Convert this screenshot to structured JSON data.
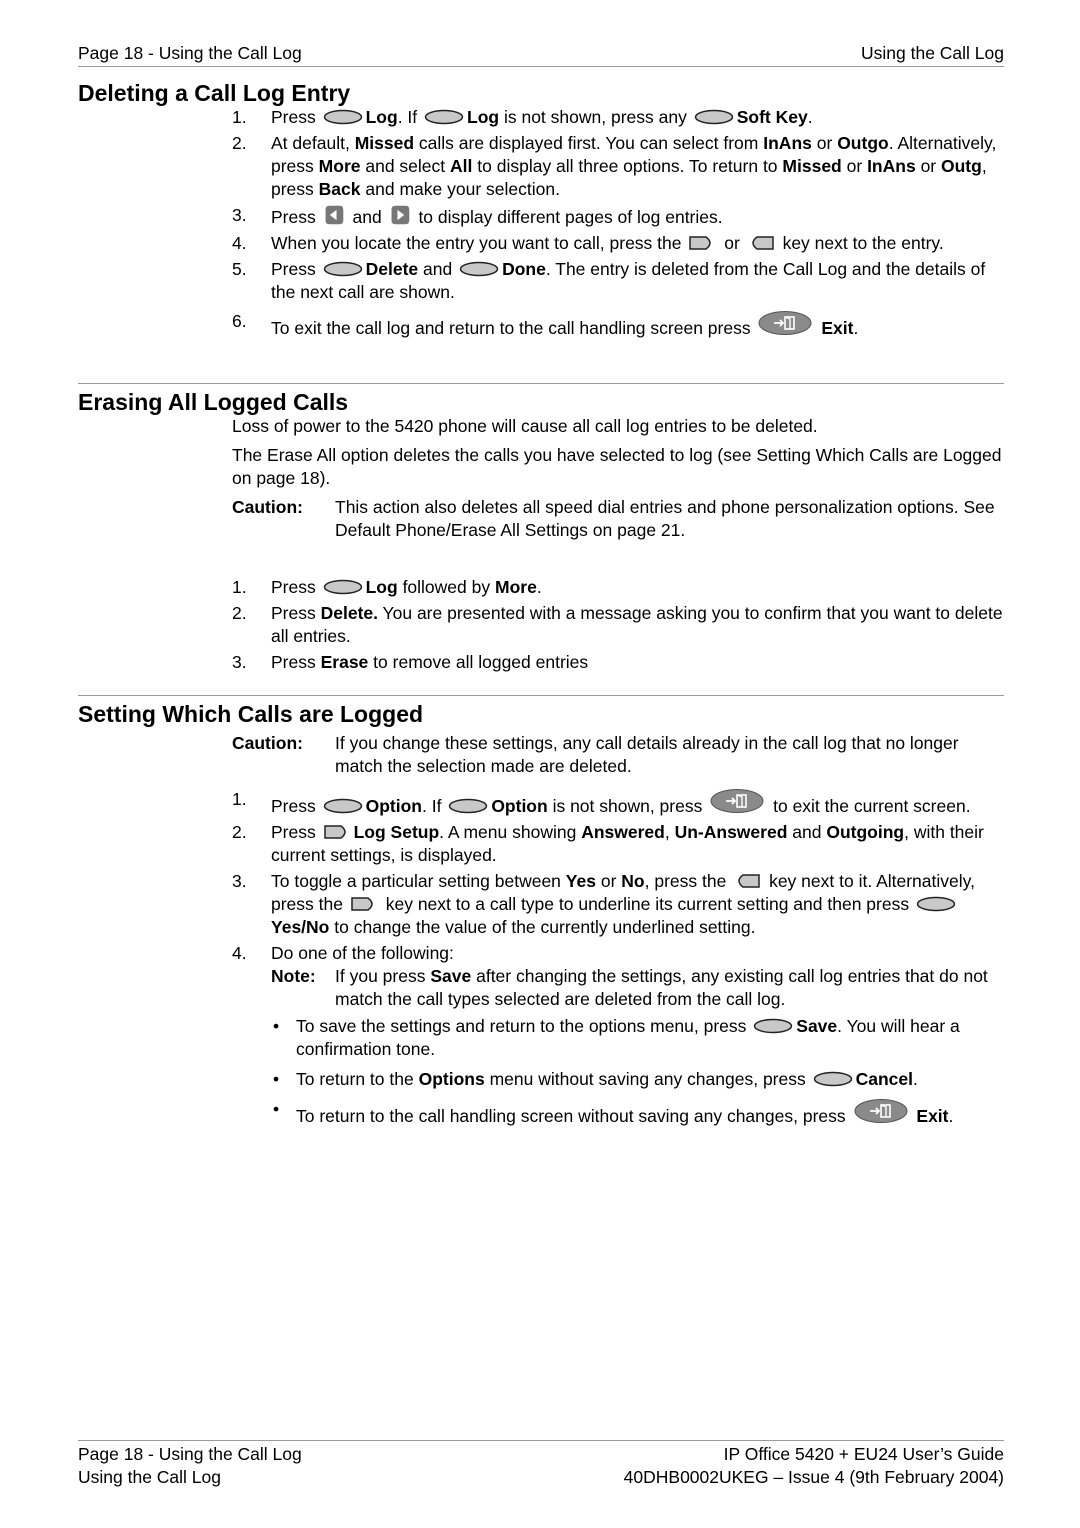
{
  "header": {
    "left": "Page 18 - Using the Call Log",
    "right": "Using the Call Log"
  },
  "sections": {
    "deleting": {
      "title": "Deleting a Call Log Entry",
      "steps": [
        {
          "num": "1.",
          "t1": "Press",
          "b1": "Log",
          "t2": ". If",
          "b2": "Log",
          "t3": "is not shown, press any",
          "b3": "Soft Key",
          "t4": "."
        },
        {
          "num": "2.",
          "t1": "At default,",
          "b1": "Missed",
          "t2": "calls are displayed first. You can select from",
          "b2": "InAns",
          "t3": "or",
          "b3": "Outgo",
          "t4": ". Alternatively, press",
          "b4": "More",
          "t5": "and select",
          "b5": "All",
          "t6": "to display all three options. To return to",
          "b6": "Missed",
          "t7": "or",
          "b7": "InAns",
          "t8": "or",
          "b8": "Outg",
          "t9": ", press",
          "b9": "Back",
          "t10": "and make your selection."
        },
        {
          "num": "3.",
          "t1": "Press",
          "t2": "and",
          "t3": "to display different pages of log entries."
        },
        {
          "num": "4.",
          "t1": "When you locate the entry you want to call, press the",
          "t2": "or",
          "t3": "key next to the entry."
        },
        {
          "num": "5.",
          "t1": "Press",
          "b1": "Delete",
          "t2": "and",
          "b2": "Done",
          "t3": ". The entry is deleted from the Call Log and the details of the next call are shown."
        },
        {
          "num": "6.",
          "t1": "To exit the call log and return to the call handling screen press",
          "b1": "Exit",
          "t2": "."
        }
      ]
    },
    "erasing": {
      "title": "Erasing All Logged Calls",
      "p1": "Loss of power to the 5420 phone will cause all call log entries to be deleted.",
      "p2": "The Erase All option deletes the calls you have selected to log  (see Setting Which Calls are Logged on page 18).",
      "caution_label": "Caution:",
      "caution_text": "This action also deletes all speed dial entries and phone personalization options. See Default Phone/Erase All Settings on page 21.",
      "steps": [
        {
          "num": "1.",
          "t1": "Press",
          "b1": "Log",
          "t2": "followed by",
          "b2": "More",
          "t3": "."
        },
        {
          "num": "2.",
          "t1": "Press",
          "b1": "Delete.",
          "t2": "You are presented with a message asking you to confirm that you want to delete all entries."
        },
        {
          "num": "3.",
          "t1": "Press",
          "b1": "Erase",
          "t2": "to remove all logged entries"
        }
      ]
    },
    "setting": {
      "title": "Setting Which Calls are Logged",
      "caution_label": "Caution:",
      "caution_text": "If you change these settings, any call details already in the call log that no longer match the selection made are deleted.",
      "steps": [
        {
          "num": "1.",
          "t1": "Press",
          "b1": "Option",
          "t2": ". If",
          "b2": "Option",
          "t3": "is not shown, press",
          "t4": "to exit the current screen."
        },
        {
          "num": "2.",
          "t1": "Press",
          "b1": "Log Setup",
          "t2": ". A menu showing",
          "b2": "Answered",
          "t3": ",",
          "b3": "Un-Answered",
          "t4": "and",
          "b4": "Outgoing",
          "t5": ", with their current settings, is displayed."
        },
        {
          "num": "3.",
          "t1": "To toggle a particular setting between",
          "b1": "Yes",
          "t2": "or",
          "b2": "No",
          "t3": ", press the",
          "t4": "key next to it. Alternatively, press the",
          "t5": "key next to a call type to underline its current setting and then press",
          "b3": "Yes/No",
          "t6": "to change the value of the currently underlined setting."
        },
        {
          "num": "4.",
          "t1": "Do one of the following:"
        }
      ],
      "note_label": "Note:",
      "note": {
        "t1": "If you press",
        "b1": "Save",
        "t2": "after changing the settings, any existing call log entries that do not match the call types selected are deleted from the call log."
      },
      "bullets": [
        {
          "t1": "To save the settings and return to the options menu, press",
          "b1": "Save",
          "t2": ". You will hear a confirmation tone."
        },
        {
          "t1": "To return to the",
          "b1": "Options",
          "t2": "menu without saving any changes, press",
          "b2": "Cancel",
          "t3": "."
        },
        {
          "t1": "To return to the call handling screen without saving any changes, press",
          "b1": "Exit",
          "t2": "."
        }
      ],
      "bullet_char": "•"
    }
  },
  "footer": {
    "left1": "Page 18 - Using the Call Log",
    "right1": "IP Office 5420 + EU24 User’s Guide",
    "left2": "Using the Call Log",
    "right2": "40DHB0002UKEG – Issue 4 (9th February 2004)"
  },
  "icons": {
    "soft_key": "soft-key-oval-icon",
    "left_line_key": "left-line-key-icon",
    "right_line_key": "right-line-key-icon",
    "left_arrow_key": "left-arrow-key-icon",
    "right_arrow_key": "right-arrow-key-icon",
    "exit_key": "exit-key-icon"
  }
}
